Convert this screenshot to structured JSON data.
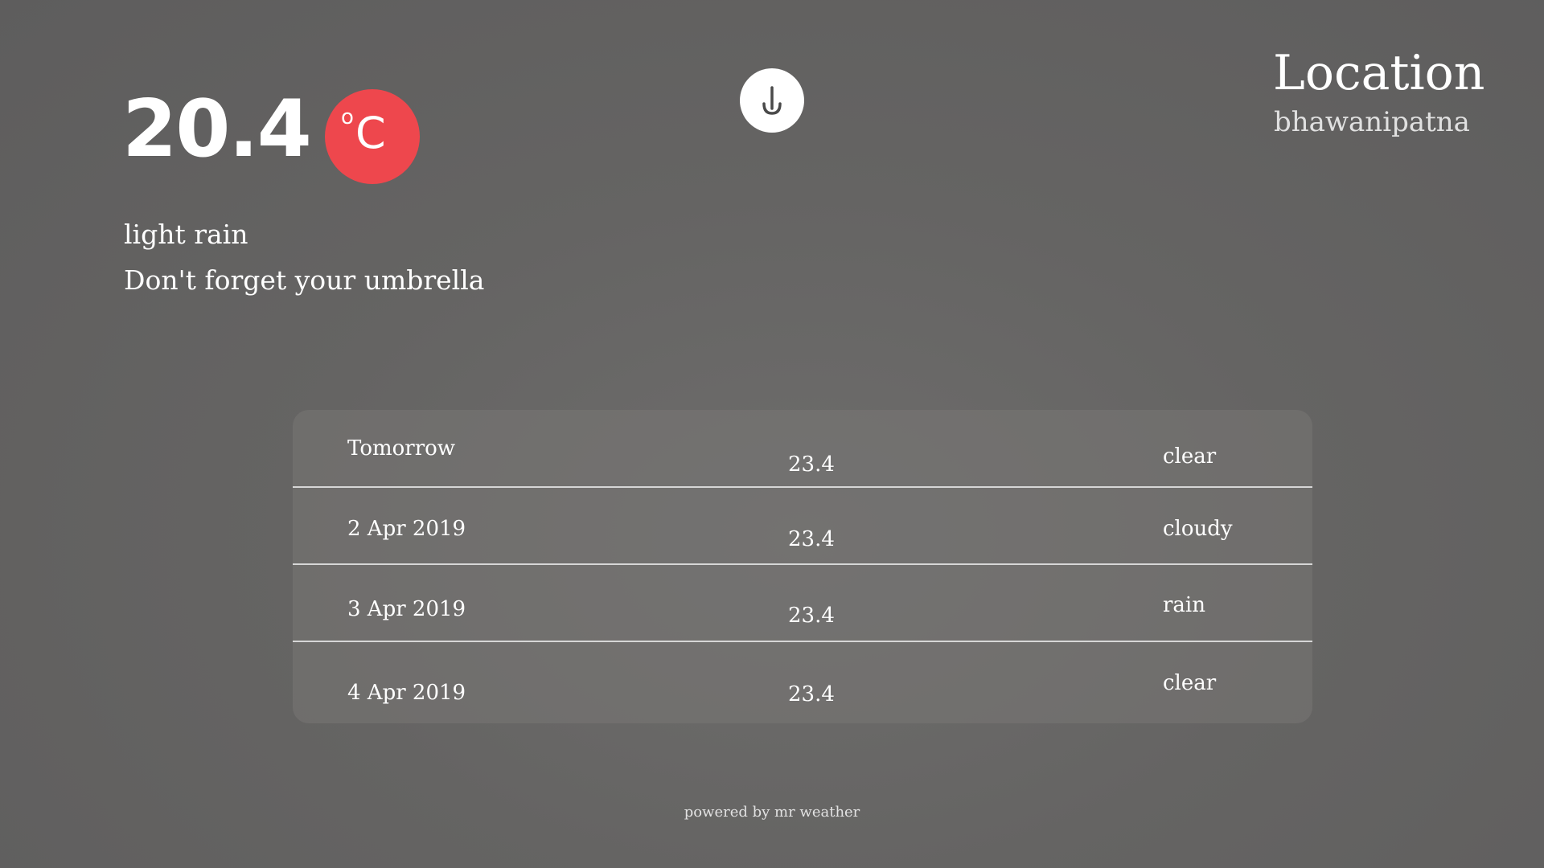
{
  "current": {
    "temperature": "20.4",
    "unit_degree": "o",
    "unit_letter": "C",
    "condition": "light rain",
    "advice": "Don't forget your umbrella"
  },
  "location": {
    "title": "Location",
    "name": "bhawanipatna"
  },
  "forecast": [
    {
      "day": "Tomorrow",
      "temp": "23.4",
      "condition": "clear"
    },
    {
      "day": "2 Apr 2019",
      "temp": "23.4",
      "condition": "cloudy"
    },
    {
      "day": "3 Apr 2019",
      "temp": "23.4",
      "condition": "rain"
    },
    {
      "day": "4 Apr 2019",
      "temp": "23.4",
      "condition": "clear"
    }
  ],
  "footer": {
    "text": "powered by mr weather"
  },
  "icons": {
    "download": "arrow-down-icon"
  },
  "colors": {
    "unit_badge": "#ee474d",
    "background": "#636262"
  }
}
